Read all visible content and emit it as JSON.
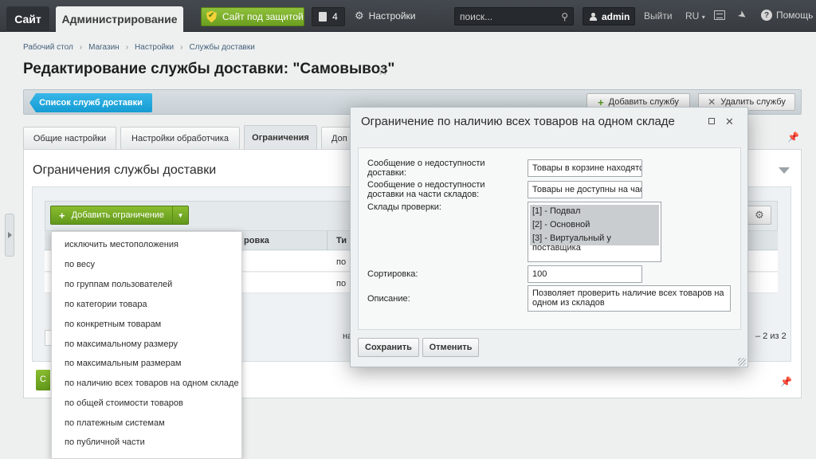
{
  "topbar": {
    "site_tab": "Сайт",
    "admin_tab": "Администрирование",
    "secure_label": "Сайт под защитой",
    "counter": "4",
    "settings_label": "Настройки",
    "search_placeholder": "поиск...",
    "user": "admin",
    "logout": "Выйти",
    "lang": "RU",
    "help": "Помощь"
  },
  "breadcrumb": [
    "Рабочий стол",
    "Магазин",
    "Настройки",
    "Службы доставки"
  ],
  "page": {
    "title": "Редактирование службы доставки: \"Самовывоз\""
  },
  "toolbar": {
    "list_label": "Список служб доставки",
    "add_label": "Добавить службу",
    "delete_label": "Удалить службу"
  },
  "tabs": [
    "Общие настройки",
    "Настройки обработчика",
    "Ограничения",
    "Доп"
  ],
  "section": {
    "title": "Ограничения службы доставки",
    "add_restriction": "Добавить ограничение"
  },
  "grid": {
    "col_visible": "ровка",
    "col_type": "Ти",
    "rows": [
      {
        "type_partial": "по"
      },
      {
        "type_partial": "по"
      }
    ],
    "footer_partial": "на",
    "pager": "– 2 из 2",
    "save_partial": "С"
  },
  "dropdown": {
    "items": [
      "исключить местоположения",
      "по весу",
      "по группам пользователей",
      "по категории товара",
      "по конкретным товарам",
      "по максимальному размеру",
      "по максимальным размерам",
      "по наличию всех товаров на одном складе",
      "по общей стоимости товаров",
      "по платежным системам",
      "по публичной части"
    ]
  },
  "dialog": {
    "title": "Ограничение по наличию всех товаров на одном складе",
    "msg_unavailable_label": "Сообщение о недоступности доставки:",
    "msg_unavailable_value": "Товары в корзине находятся",
    "msg_partial_label": "Сообщение о недоступности доставки на части складов:",
    "msg_partial_value": "Товары не доступны на част",
    "warehouses_label": "Склады проверки:",
    "warehouses": [
      "[1] - Подвал",
      "[2] - Основной",
      "[3] - Виртуальный у поставщика"
    ],
    "sort_label": "Сортировка:",
    "sort_value": "100",
    "desc_label": "Описание:",
    "desc_value": "Позволяет проверить наличие всех товаров на одном из складов",
    "save": "Сохранить",
    "cancel": "Отменить"
  }
}
